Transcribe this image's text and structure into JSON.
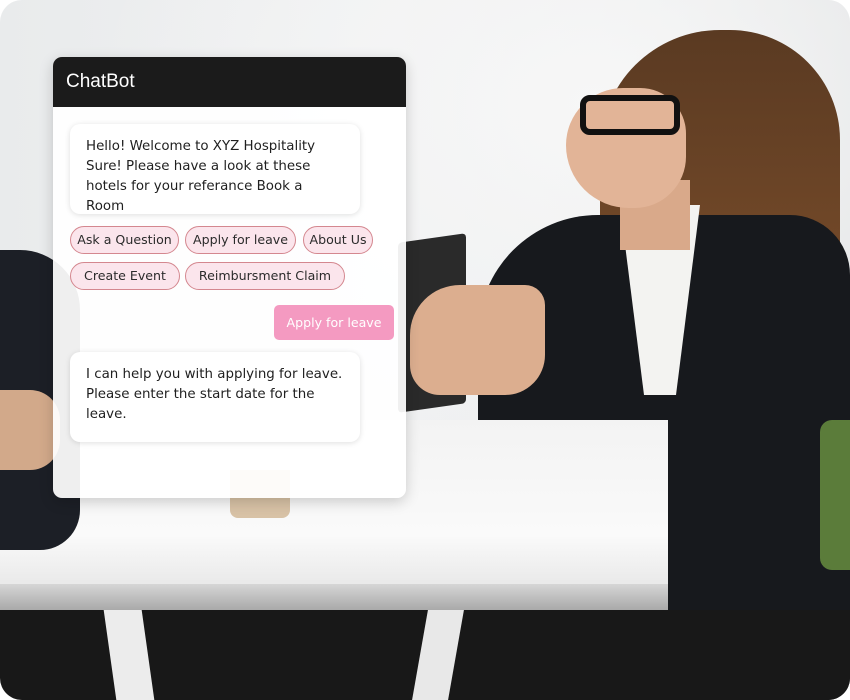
{
  "chat": {
    "title": "ChatBot",
    "messages": [
      {
        "sender": "bot",
        "text": "Hello! Welcome to XYZ Hospitality Sure! Please have a look at these hotels for your referance Book a Room"
      },
      {
        "sender": "user",
        "text": "Apply for leave"
      },
      {
        "sender": "bot",
        "text": "I can help you with applying for leave. Please enter the start date for the leave."
      }
    ],
    "quick_replies": [
      "Ask a Question",
      "Apply for leave",
      "About Us",
      "Create Event",
      "Reimbursment Claim"
    ]
  },
  "colors": {
    "header_bg": "#1b1b1b",
    "chip_bg": "#fbe5ec",
    "chip_border": "#d4878f",
    "user_bubble": "#f49ac1"
  }
}
